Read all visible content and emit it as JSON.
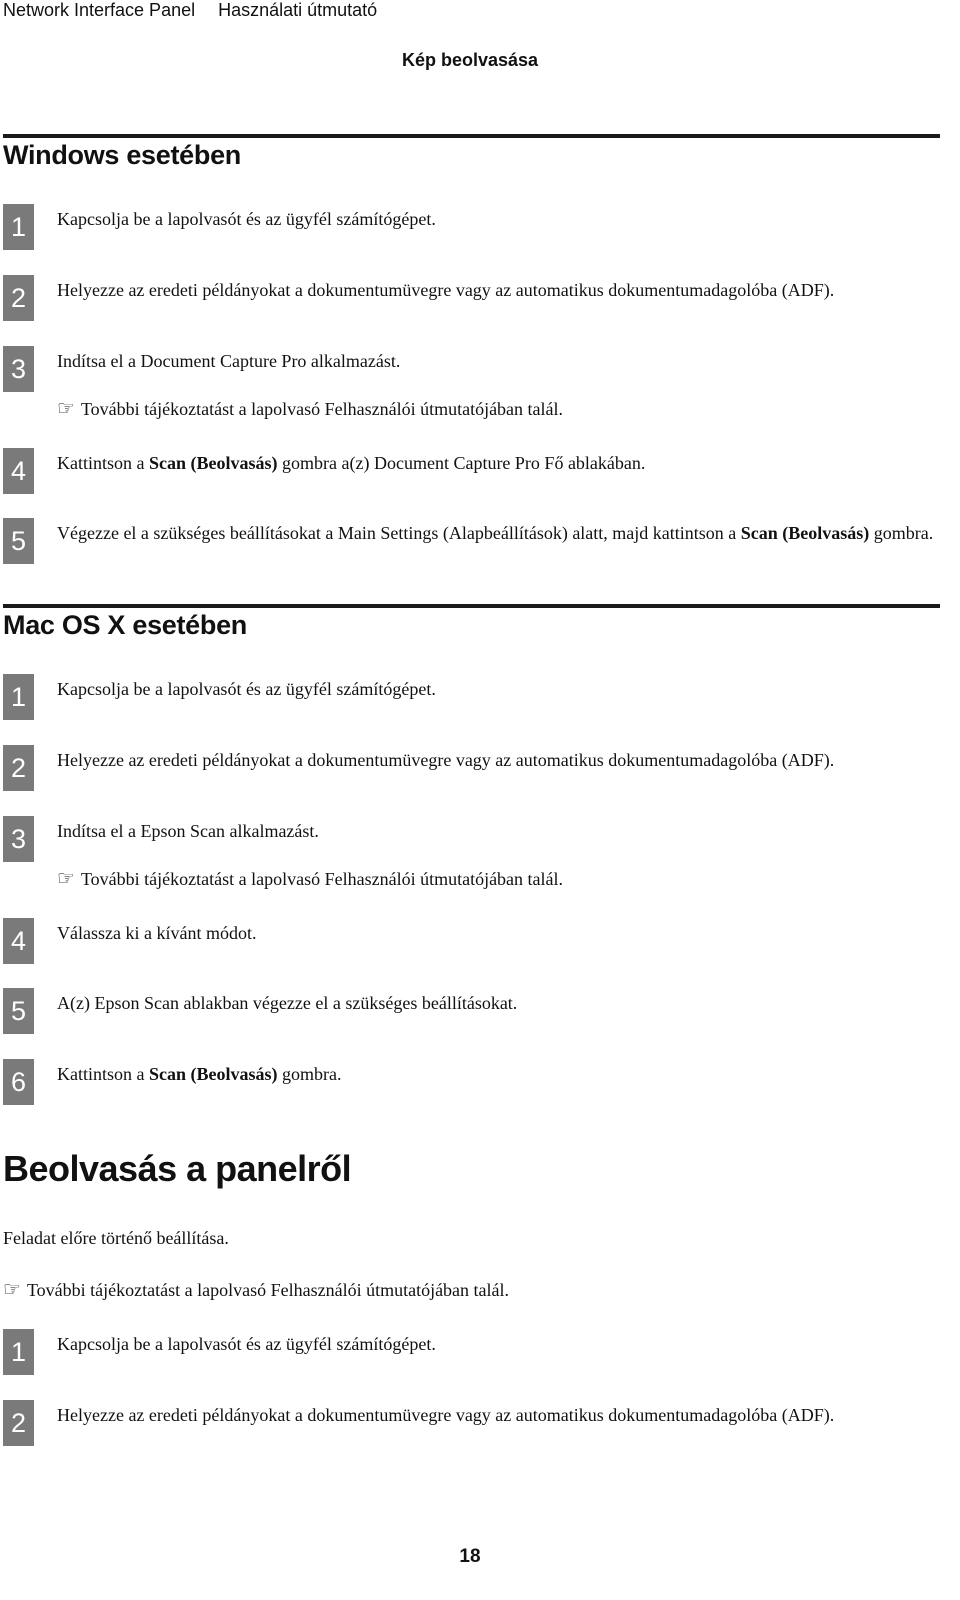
{
  "header": {
    "product": "Network Interface Panel",
    "guide": "Használati útmutató",
    "chapter": "Kép beolvasása"
  },
  "sections": {
    "windows": {
      "title": "Windows esetében",
      "steps": [
        {
          "num": "1",
          "text": "Kapcsolja be a lapolvasót és az ügyfél számítógépet."
        },
        {
          "num": "2",
          "text": "Helyezze az eredeti példányokat a dokumentumüvegre vagy az automatikus dokumentumadagolóba (ADF)."
        },
        {
          "num": "3",
          "text": "Indítsa el a Document Capture Pro alkalmazást.",
          "ref": "További tájékoztatást a lapolvasó Felhasználói útmutatójában talál."
        },
        {
          "num": "4",
          "pre": "Kattintson a ",
          "bold": "Scan (Beolvasás)",
          "post": " gombra a(z) Document Capture Pro Fő ablakában."
        },
        {
          "num": "5",
          "pre": "Végezze el a szükséges beállításokat a Main Settings (Alapbeállítások) alatt, majd kattintson a ",
          "bold": "Scan (Beolvasás)",
          "post": " gombra."
        }
      ]
    },
    "mac": {
      "title": "Mac OS X esetében",
      "steps": [
        {
          "num": "1",
          "text": "Kapcsolja be a lapolvasót és az ügyfél számítógépet."
        },
        {
          "num": "2",
          "text": "Helyezze az eredeti példányokat a dokumentumüvegre vagy az automatikus dokumentumadagolóba (ADF)."
        },
        {
          "num": "3",
          "text": "Indítsa el a Epson Scan alkalmazást.",
          "ref": "További tájékoztatást a lapolvasó Felhasználói útmutatójában talál."
        },
        {
          "num": "4",
          "text": "Válassza ki a kívánt módot."
        },
        {
          "num": "5",
          "text": "A(z) Epson Scan ablakban végezze el a szükséges beállításokat."
        },
        {
          "num": "6",
          "pre": "Kattintson a ",
          "bold": "Scan (Beolvasás)",
          "post": " gombra."
        }
      ]
    },
    "panel": {
      "title": "Beolvasás a panelről",
      "intro": "Feladat előre történő beállítása.",
      "ref": "További tájékoztatást a lapolvasó Felhasználói útmutatójában talál.",
      "steps": [
        {
          "num": "1",
          "text": "Kapcsolja be a lapolvasót és az ügyfél számítógépet."
        },
        {
          "num": "2",
          "text": "Helyezze az eredeti példányokat a dokumentumüvegre vagy az automatikus dokumentumadagolóba (ADF)."
        }
      ]
    }
  },
  "icons": {
    "reference": "☞"
  },
  "page_number": "18"
}
